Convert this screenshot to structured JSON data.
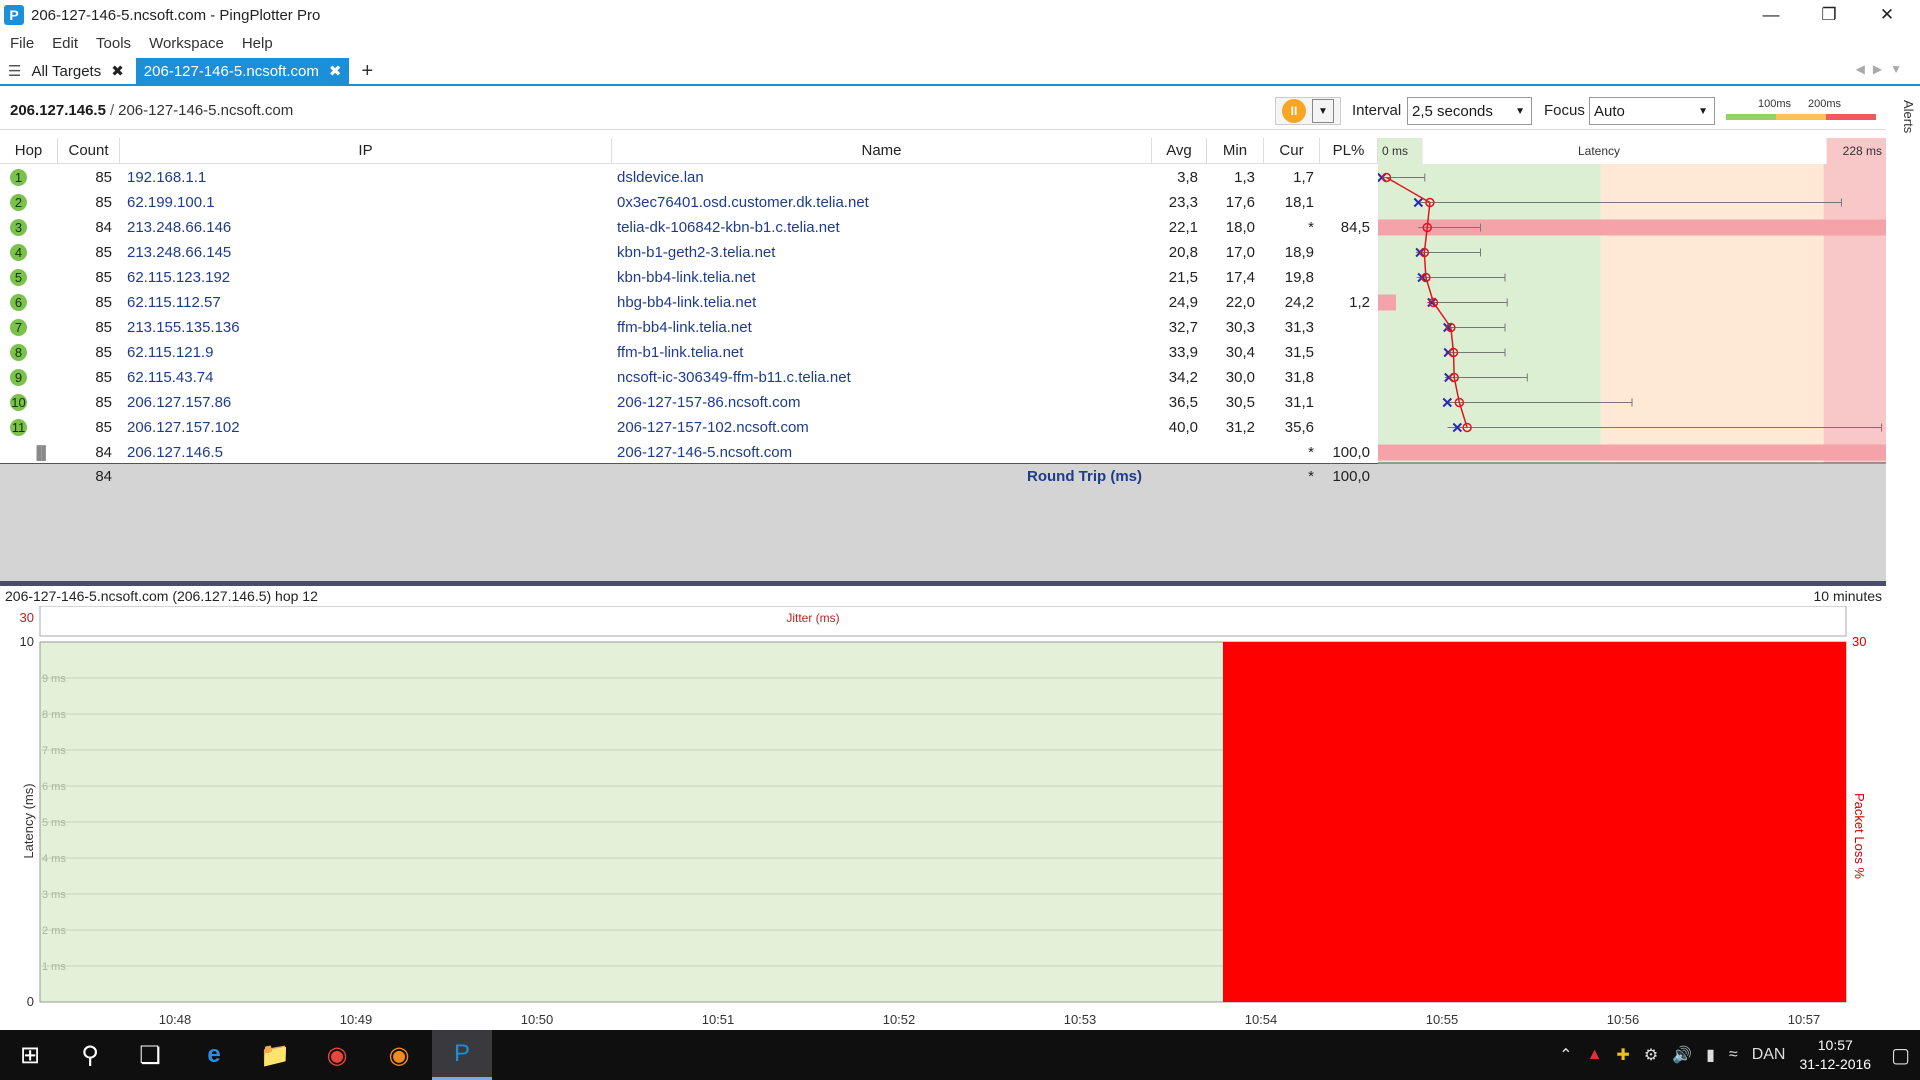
{
  "window": {
    "title": "206-127-146-5.ncsoft.com - PingPlotter Pro",
    "app_icon": "pingplotter-logo-icon"
  },
  "menu": [
    "File",
    "Edit",
    "Tools",
    "Workspace",
    "Help"
  ],
  "tabs": {
    "all_targets": "All Targets",
    "active": "206-127-146-5.ncsoft.com"
  },
  "toolbar": {
    "target_ip": "206.127.146.5",
    "separator": "/",
    "target_host": "206-127-146-5.ncsoft.com",
    "interval_label": "Interval",
    "interval_value": "2,5 seconds",
    "focus_label": "Focus",
    "focus_value": "Auto",
    "scale_100": "100ms",
    "scale_200": "200ms",
    "alerts_label": "Alerts"
  },
  "table": {
    "headers": {
      "hop": "Hop",
      "count": "Count",
      "ip": "IP",
      "name": "Name",
      "avg": "Avg",
      "min": "Min",
      "cur": "Cur",
      "pl": "PL%",
      "latency": "Latency",
      "lat_min": "0 ms",
      "lat_max": "228 ms"
    },
    "rows": [
      {
        "hop": "1",
        "count": "85",
        "ip": "192.168.1.1",
        "name": "dsldevice.lan",
        "avg": "3,8",
        "min": "1,3",
        "cur": "1,7",
        "pl": ""
      },
      {
        "hop": "2",
        "count": "85",
        "ip": "62.199.100.1",
        "name": "0x3ec76401.osd.customer.dk.telia.net",
        "avg": "23,3",
        "min": "17,6",
        "cur": "18,1",
        "pl": ""
      },
      {
        "hop": "3",
        "count": "84",
        "ip": "213.248.66.146",
        "name": "telia-dk-106842-kbn-b1.c.telia.net",
        "avg": "22,1",
        "min": "18,0",
        "cur": "*",
        "pl": "84,5"
      },
      {
        "hop": "4",
        "count": "85",
        "ip": "213.248.66.145",
        "name": "kbn-b1-geth2-3.telia.net",
        "avg": "20,8",
        "min": "17,0",
        "cur": "18,9",
        "pl": ""
      },
      {
        "hop": "5",
        "count": "85",
        "ip": "62.115.123.192",
        "name": "kbn-bb4-link.telia.net",
        "avg": "21,5",
        "min": "17,4",
        "cur": "19,8",
        "pl": ""
      },
      {
        "hop": "6",
        "count": "85",
        "ip": "62.115.112.57",
        "name": "hbg-bb4-link.telia.net",
        "avg": "24,9",
        "min": "22,0",
        "cur": "24,2",
        "pl": "1,2"
      },
      {
        "hop": "7",
        "count": "85",
        "ip": "213.155.135.136",
        "name": "ffm-bb4-link.telia.net",
        "avg": "32,7",
        "min": "30,3",
        "cur": "31,3",
        "pl": ""
      },
      {
        "hop": "8",
        "count": "85",
        "ip": "62.115.121.9",
        "name": "ffm-b1-link.telia.net",
        "avg": "33,9",
        "min": "30,4",
        "cur": "31,5",
        "pl": ""
      },
      {
        "hop": "9",
        "count": "85",
        "ip": "62.115.43.74",
        "name": "ncsoft-ic-306349-ffm-b11.c.telia.net",
        "avg": "34,2",
        "min": "30,0",
        "cur": "31,8",
        "pl": ""
      },
      {
        "hop": "10",
        "count": "85",
        "ip": "206.127.157.86",
        "name": "206-127-157-86.ncsoft.com",
        "avg": "36,5",
        "min": "30,5",
        "cur": "31,1",
        "pl": ""
      },
      {
        "hop": "11",
        "count": "85",
        "ip": "206.127.157.102",
        "name": "206-127-157-102.ncsoft.com",
        "avg": "40,0",
        "min": "31,2",
        "cur": "35,6",
        "pl": ""
      },
      {
        "hop": "",
        "count": "84",
        "ip": "206.127.146.5",
        "name": "206-127-146-5.ncsoft.com",
        "avg": "",
        "min": "",
        "cur": "*",
        "pl": "100,0"
      }
    ],
    "round_trip": {
      "count": "84",
      "label": "Round Trip (ms)",
      "cur": "*",
      "pl": "100,0"
    }
  },
  "latency_graph": {
    "min_ms": 0,
    "max_ms": 228,
    "zone_green_to": 100,
    "zone_yellow_to": 200,
    "colors": {
      "green": "#dcefd2",
      "yellow": "#fde9d4",
      "red": "#f8c7c7",
      "loss": "#f4a3a8"
    },
    "hops": [
      {
        "cur": 1.7,
        "avg": 3.8,
        "min": 1.3,
        "max": 21,
        "loss": 0
      },
      {
        "cur": 18.1,
        "avg": 23.3,
        "min": 17.6,
        "max": 208,
        "loss": 0
      },
      {
        "cur": null,
        "avg": 22.1,
        "min": 18.0,
        "max": 46,
        "loss": 84.5
      },
      {
        "cur": 18.9,
        "avg": 20.8,
        "min": 17.0,
        "max": 46,
        "loss": 0
      },
      {
        "cur": 19.8,
        "avg": 21.5,
        "min": 17.4,
        "max": 57,
        "loss": 0
      },
      {
        "cur": 24.2,
        "avg": 24.9,
        "min": 22.0,
        "max": 58,
        "loss": 1.2
      },
      {
        "cur": 31.3,
        "avg": 32.7,
        "min": 30.3,
        "max": 57,
        "loss": 0
      },
      {
        "cur": 31.5,
        "avg": 33.9,
        "min": 30.4,
        "max": 57,
        "loss": 0
      },
      {
        "cur": 31.8,
        "avg": 34.2,
        "min": 30.0,
        "max": 67,
        "loss": 0
      },
      {
        "cur": 31.1,
        "avg": 36.5,
        "min": 30.5,
        "max": 114,
        "loss": 0
      },
      {
        "cur": 35.6,
        "avg": 40.0,
        "min": 31.2,
        "max": 226,
        "loss": 0
      },
      {
        "cur": null,
        "avg": null,
        "min": null,
        "max": null,
        "loss": 100
      }
    ]
  },
  "bottom_graph": {
    "header_left": "206-127-146-5.ncsoft.com (206.127.146.5) hop 12",
    "header_right": "10 minutes",
    "jitter_label": "Jitter (ms)",
    "jitter_max": "30",
    "y_label": "Latency (ms)",
    "y_right_label": "Packet Loss %",
    "y_right_max": "30",
    "y_ticks": [
      "10",
      "9 ms",
      "8 ms",
      "7 ms",
      "6 ms",
      "5 ms",
      "4 ms",
      "3 ms",
      "2 ms",
      "1 ms",
      "0"
    ],
    "x_ticks": [
      "10:48",
      "10:49",
      "10:50",
      "10:51",
      "10:52",
      "10:53",
      "10:54",
      "10:55",
      "10:56",
      "10:57"
    ],
    "loss_start_minute": 10.9,
    "colors": {
      "bg": "#e3f1d8",
      "loss": "#ff0000",
      "grid": "#c7d4bd"
    }
  },
  "taskbar": {
    "language": "DAN",
    "time": "10:57",
    "date": "31-12-2016"
  }
}
